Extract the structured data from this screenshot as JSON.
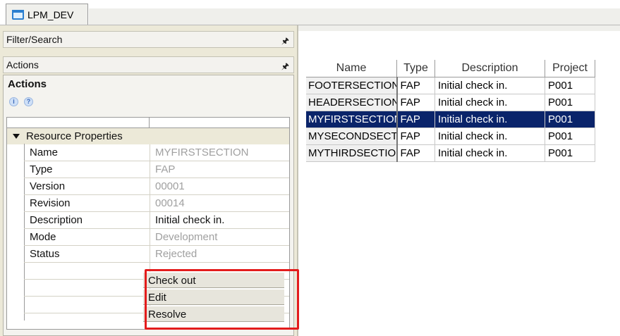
{
  "tab": {
    "title": "LPM_DEV"
  },
  "panels": {
    "filter_search": "Filter/Search",
    "actions": "Actions",
    "pin_symbol": "⨍"
  },
  "actions_box": {
    "title": "Actions",
    "icons": [
      "info-icon",
      "help-icon"
    ]
  },
  "resource_properties": {
    "section_label": "Resource Properties",
    "rows": [
      {
        "key": "Name",
        "value": "MYFIRSTSECTION",
        "dim": true
      },
      {
        "key": "Type",
        "value": "FAP",
        "dim": true
      },
      {
        "key": "Version",
        "value": "00001",
        "dim": true
      },
      {
        "key": "Revision",
        "value": "00014",
        "dim": true
      },
      {
        "key": "Description",
        "value": "Initial check in.",
        "dim": false
      },
      {
        "key": "Mode",
        "value": "Development",
        "dim": true
      },
      {
        "key": "Status",
        "value": "Rejected",
        "dim": true
      }
    ],
    "buttons": [
      "Check out",
      "Edit",
      "Resolve"
    ]
  },
  "resources_table": {
    "columns": [
      "Name",
      "Type",
      "Description",
      "Project"
    ],
    "rows": [
      {
        "name": "FOOTERSECTION",
        "type": "FAP",
        "description": "Initial check in.",
        "project": "P001",
        "selected": false
      },
      {
        "name": "HEADERSECTION",
        "type": "FAP",
        "description": "Initial check in.",
        "project": "P001",
        "selected": false
      },
      {
        "name": "MYFIRSTSECTION",
        "type": "FAP",
        "description": "Initial check in.",
        "project": "P001",
        "selected": true
      },
      {
        "name": "MYSECONDSECTION",
        "type": "FAP",
        "description": "Initial check in.",
        "project": "P001",
        "selected": false
      },
      {
        "name": "MYTHIRDSECTION",
        "type": "FAP",
        "description": "Initial check in.",
        "project": "P001",
        "selected": false
      }
    ]
  },
  "colors": {
    "selection": "#0a246a",
    "highlight_box": "#e31c1c",
    "panel_bg": "#ece9d8"
  }
}
